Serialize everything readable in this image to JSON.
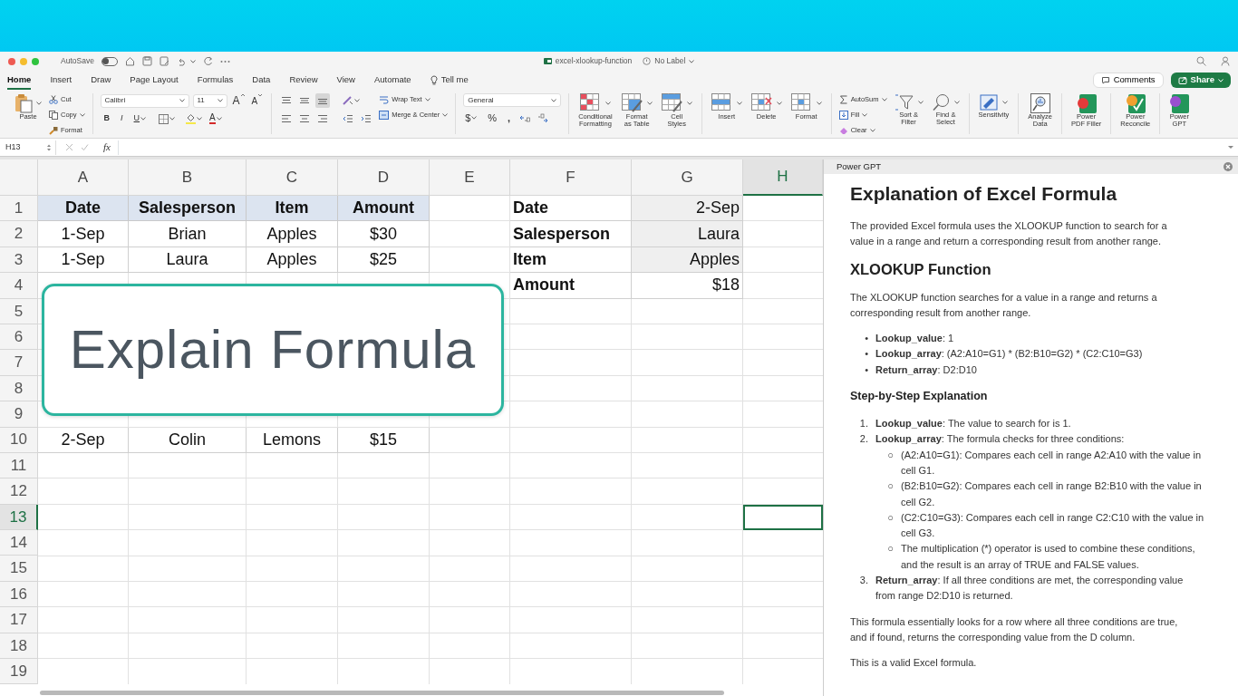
{
  "window": {
    "title": "excel-xlookup-function",
    "label": "No Label",
    "autosave": {
      "label": "AutoSave",
      "on": false
    }
  },
  "ribbon_tabs": [
    {
      "label": "Home",
      "selected": true
    },
    {
      "label": "Insert",
      "selected": false
    },
    {
      "label": "Draw",
      "selected": false
    },
    {
      "label": "Page Layout",
      "selected": false
    },
    {
      "label": "Formulas",
      "selected": false
    },
    {
      "label": "Data",
      "selected": false
    },
    {
      "label": "Review",
      "selected": false
    },
    {
      "label": "View",
      "selected": false
    },
    {
      "label": "Automate",
      "selected": false
    }
  ],
  "tell_me": "Tell me",
  "header_buttons": {
    "comments": "Comments",
    "share": "Share"
  },
  "ribbon": {
    "clipboard": {
      "paste": "Paste",
      "items": [
        "Cut",
        "Copy",
        "Format"
      ]
    },
    "font": {
      "name": "Calibri",
      "size": "11",
      "grow_shrink": [
        "A",
        "A"
      ],
      "styles": [
        "B",
        "I",
        "U"
      ],
      "color_letter": "A"
    },
    "vertical_align": [
      {
        "selected": false
      },
      {
        "selected": false
      },
      {
        "selected": true
      }
    ],
    "alignment": {
      "wrap": "Wrap Text",
      "merge": "Merge & Center"
    },
    "number": {
      "format": "General",
      "symbols": [
        "$",
        "%",
        ","
      ]
    },
    "styles": [
      "Conditional\nFormatting",
      "Format\nas Table",
      "Cell\nStyles"
    ],
    "cells": [
      "Insert",
      "Delete",
      "Format"
    ],
    "editing": {
      "items": [
        "AutoSum",
        "Fill",
        "Clear"
      ],
      "buttons": [
        "Sort &\nFilter",
        "Find &\nSelect"
      ]
    },
    "add_ins": [
      "Sensitivity",
      "Analyze\nData",
      "Power\nPDF Filler",
      "Power\nReconcile",
      "Power\nGPT"
    ]
  },
  "formula_bar": {
    "name_box": "H13",
    "function_label": "fx"
  },
  "sheet": {
    "columns": [
      {
        "label": "A",
        "selected": false
      },
      {
        "label": "B",
        "selected": false
      },
      {
        "label": "C",
        "selected": false
      },
      {
        "label": "D",
        "selected": false
      },
      {
        "label": "E",
        "selected": false
      },
      {
        "label": "F",
        "selected": false
      },
      {
        "label": "G",
        "selected": false
      },
      {
        "label": "H",
        "selected": true
      }
    ],
    "rows": [
      {
        "number": "1",
        "selected": false,
        "cells": {
          "A": {
            "text": "Date",
            "kind": "header"
          },
          "B": {
            "text": "Salesperson",
            "kind": "header"
          },
          "C": {
            "text": "Item",
            "kind": "header"
          },
          "D": {
            "text": "Amount",
            "kind": "header"
          },
          "F": {
            "text": "Date",
            "kind": "label"
          },
          "G": {
            "text": "2-Sep",
            "kind": "value"
          }
        }
      },
      {
        "number": "2",
        "selected": false,
        "cells": {
          "A": {
            "text": "1-Sep",
            "kind": "data"
          },
          "B": {
            "text": "Brian",
            "kind": "data"
          },
          "C": {
            "text": "Apples",
            "kind": "data"
          },
          "D": {
            "text": "$30",
            "kind": "data"
          },
          "F": {
            "text": "Salesperson",
            "kind": "label"
          },
          "G": {
            "text": "Laura",
            "kind": "value"
          }
        }
      },
      {
        "number": "3",
        "selected": false,
        "cells": {
          "A": {
            "text": "1-Sep",
            "kind": "data"
          },
          "B": {
            "text": "Laura",
            "kind": "data"
          },
          "C": {
            "text": "Apples",
            "kind": "data"
          },
          "D": {
            "text": "$25",
            "kind": "data"
          },
          "F": {
            "text": "Item",
            "kind": "label"
          },
          "G": {
            "text": "Apples",
            "kind": "value"
          }
        }
      },
      {
        "number": "4",
        "selected": false,
        "cells": {
          "F": {
            "text": "Amount",
            "kind": "label"
          },
          "G": {
            "text": "$18",
            "kind": "result"
          }
        }
      },
      {
        "number": "5",
        "selected": false,
        "cells": {}
      },
      {
        "number": "6",
        "selected": false,
        "cells": {}
      },
      {
        "number": "7",
        "selected": false,
        "cells": {}
      },
      {
        "number": "8",
        "selected": false,
        "cells": {}
      },
      {
        "number": "9",
        "selected": false,
        "cells": {}
      },
      {
        "number": "10",
        "selected": false,
        "cells": {
          "A": {
            "text": "2-Sep",
            "kind": "data"
          },
          "B": {
            "text": "Colin",
            "kind": "data"
          },
          "C": {
            "text": "Lemons",
            "kind": "data"
          },
          "D": {
            "text": "$15",
            "kind": "data"
          }
        }
      },
      {
        "number": "11",
        "selected": false,
        "cells": {}
      },
      {
        "number": "12",
        "selected": false,
        "cells": {}
      },
      {
        "number": "13",
        "selected": true,
        "cells": {}
      },
      {
        "number": "14",
        "selected": false,
        "cells": {}
      },
      {
        "number": "15",
        "selected": false,
        "cells": {}
      },
      {
        "number": "16",
        "selected": false,
        "cells": {}
      },
      {
        "number": "17",
        "selected": false,
        "cells": {}
      },
      {
        "number": "18",
        "selected": false,
        "cells": {}
      },
      {
        "number": "19",
        "selected": false,
        "cells": {}
      }
    ]
  },
  "callout": {
    "text": "Explain Formula"
  },
  "task_pane": {
    "title": "Power GPT",
    "content": [
      {
        "kind": "heading1",
        "text": "Explanation of Excel Formula"
      },
      {
        "kind": "paragraph",
        "text": "The provided Excel formula uses the XLOOKUP function to search for a value in a range and return a corresponding result from another range."
      },
      {
        "kind": "heading2",
        "text": "XLOOKUP Function"
      },
      {
        "kind": "paragraph",
        "text": "The XLOOKUP function searches for a value in a range and returns a corresponding result from another range."
      },
      {
        "kind": "list",
        "items": [
          {
            "marker": "•",
            "text": "**Lookup_value**: 1"
          },
          {
            "marker": "•",
            "text": "**Lookup_array**: (A2:A10=G1) * (B2:B10=G2) * (C2:C10=G3)"
          },
          {
            "marker": "•",
            "text": "**Return_array**: D2:D10"
          }
        ]
      },
      {
        "kind": "heading3",
        "text": "Step-by-Step Explanation"
      },
      {
        "kind": "list",
        "items": [
          {
            "marker": "1.",
            "text": "**Lookup_value**: The value to search for is 1."
          },
          {
            "marker": "2.",
            "text": "**Lookup_array**: The formula checks for three conditions:",
            "children": [
              {
                "marker": "○",
                "text": "(A2:A10=G1): Compares each cell in range A2:A10 with the value in cell G1."
              },
              {
                "marker": "○",
                "text": "(B2:B10=G2): Compares each cell in range B2:B10 with the value in cell G2."
              },
              {
                "marker": "○",
                "text": "(C2:C10=G3): Compares each cell in range C2:C10 with the value in cell G3."
              },
              {
                "marker": "○",
                "text": "The multiplication (*) operator is used to combine these conditions, and the result is an array of TRUE and FALSE values."
              }
            ]
          },
          {
            "marker": "3.",
            "text": "**Return_array**: If all three conditions are met, the corresponding value from range D2:D10 is returned."
          }
        ]
      },
      {
        "kind": "paragraph",
        "text": "This formula essentially looks for a row where all three conditions are true, and if found, returns the corresponding value from the D column."
      },
      {
        "kind": "paragraph",
        "text": "This is a valid Excel formula."
      }
    ]
  }
}
